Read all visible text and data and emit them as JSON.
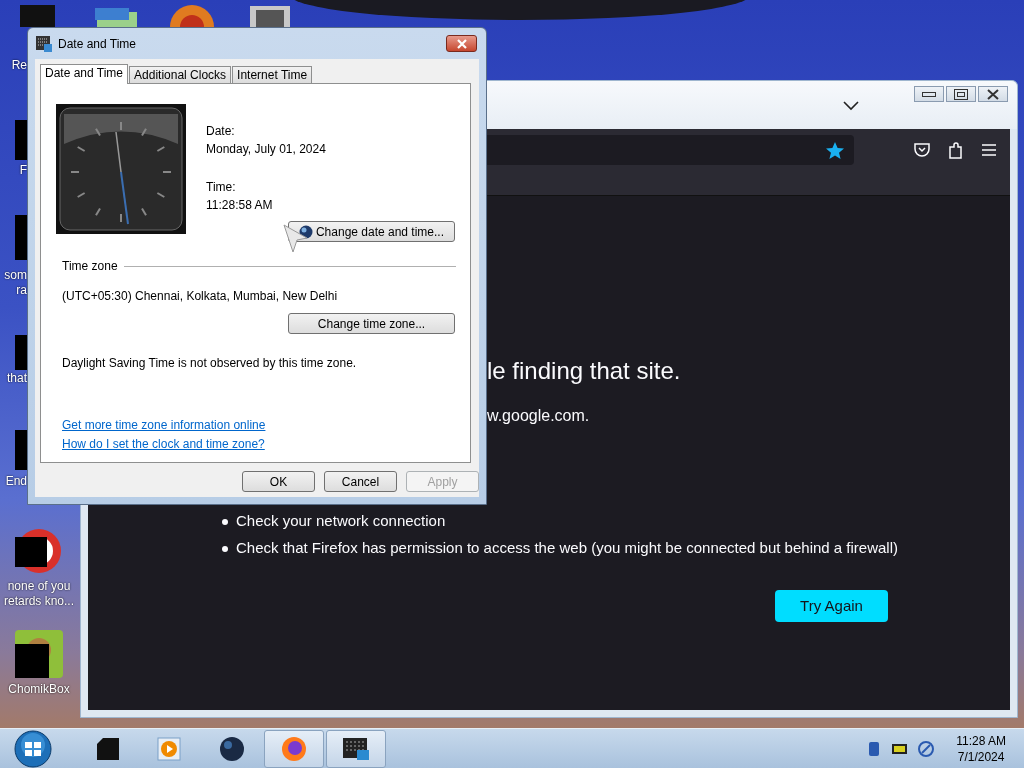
{
  "desktop": {
    "icons": [
      {
        "kind": "partial",
        "lines": [
          "Re"
        ]
      },
      {
        "kind": "partial",
        "lines": [
          "F"
        ]
      },
      {
        "kind": "partial",
        "lines": [
          "som",
          "ra"
        ]
      },
      {
        "kind": "partial",
        "lines": [
          "that"
        ]
      },
      {
        "kind": "partial",
        "lines": [
          "End"
        ]
      },
      {
        "kind": "ring",
        "lines": [
          "none of you",
          "retards kno..."
        ]
      },
      {
        "kind": "box",
        "lines": [
          "ChomikBox"
        ]
      }
    ]
  },
  "browser": {
    "error_heading": "le finding that site.",
    "error_text": "w.google.com.",
    "tips": [
      "Check your network connection",
      "Check that Firefox has permission to access the web (you might be connected but behind a firewall)"
    ],
    "try_again": "Try Again"
  },
  "dialog": {
    "title": "Date and Time",
    "tabs": [
      {
        "label": "Date and Time",
        "selected": true
      },
      {
        "label": "Additional Clocks",
        "selected": false
      },
      {
        "label": "Internet Time",
        "selected": false
      }
    ],
    "date_label": "Date:",
    "date": "Monday, July 01, 2024",
    "time_label": "Time:",
    "time": "11:28:58 AM",
    "change_datetime_button": "Change date and time...",
    "timezone_heading": "Time zone",
    "timezone": "(UTC+05:30) Chennai, Kolkata, Mumbai, New Delhi",
    "change_timezone_button": "Change time zone...",
    "dst_note": "Daylight Saving Time is not observed by this time zone.",
    "links": [
      "Get more time zone information online",
      "How do I set the clock and time zone?"
    ],
    "buttons": [
      {
        "label": "OK",
        "disabled": false
      },
      {
        "label": "Cancel",
        "disabled": false
      },
      {
        "label": "Apply",
        "disabled": true
      }
    ]
  },
  "taskbar": {
    "items": [
      {
        "kind": "device",
        "active": false
      },
      {
        "kind": "media",
        "active": false
      },
      {
        "kind": "globe",
        "active": false
      },
      {
        "kind": "firefox",
        "active": true
      },
      {
        "kind": "clockapp",
        "active": true
      }
    ],
    "clock_time": "11:28 AM",
    "clock_date": "7/1/2024"
  }
}
